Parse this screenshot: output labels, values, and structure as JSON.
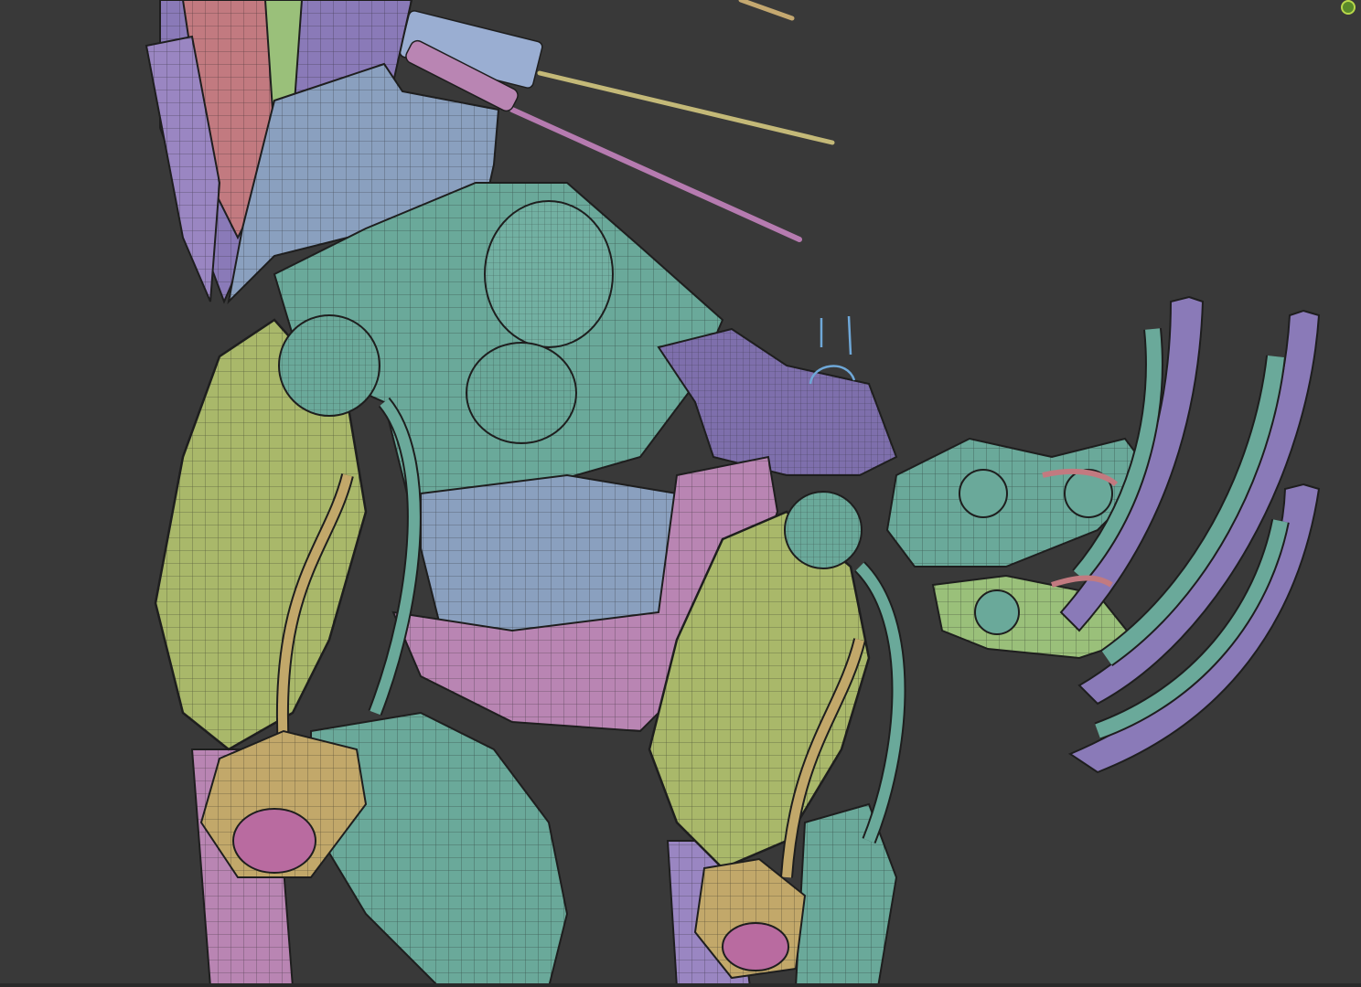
{
  "viewport": {
    "background": "#393939",
    "indicator_color": "#b8d84a",
    "mesh_colors": {
      "sage": "#a9b86a",
      "teal": "#6aa99a",
      "slate": "#8aa0bf",
      "pink": "#b985b3",
      "purple": "#8a7ab8",
      "tan": "#c2a86a",
      "red": "#c27a80",
      "lime": "#9ac07a"
    },
    "cursor_icon": "brush-cursor-icon"
  }
}
